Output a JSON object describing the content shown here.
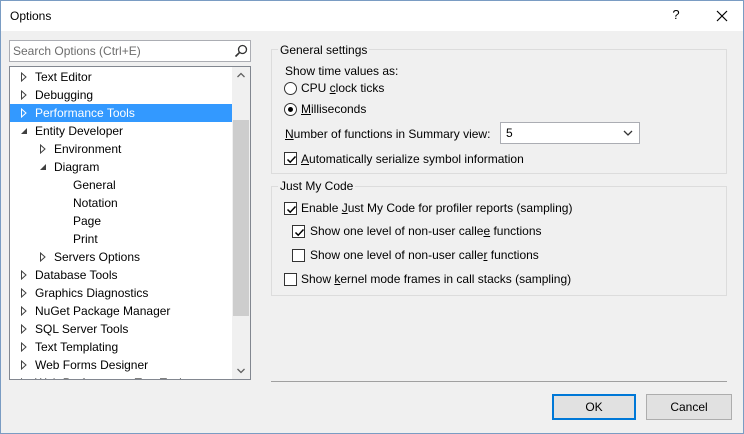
{
  "window": {
    "title": "Options",
    "help_glyph": "?"
  },
  "search": {
    "placeholder": "Search Options (Ctrl+E)",
    "value": ""
  },
  "tree": {
    "items": [
      {
        "label": "Text Editor",
        "level": 0,
        "expander": "collapsed",
        "selected": false
      },
      {
        "label": "Debugging",
        "level": 0,
        "expander": "collapsed",
        "selected": false
      },
      {
        "label": "Performance Tools",
        "level": 0,
        "expander": "collapsed",
        "selected": true
      },
      {
        "label": "Entity Developer",
        "level": 0,
        "expander": "expanded",
        "selected": false
      },
      {
        "label": "Environment",
        "level": 1,
        "expander": "collapsed",
        "selected": false
      },
      {
        "label": "Diagram",
        "level": 1,
        "expander": "expanded",
        "selected": false
      },
      {
        "label": "General",
        "level": 2,
        "expander": "none",
        "selected": false
      },
      {
        "label": "Notation",
        "level": 2,
        "expander": "none",
        "selected": false
      },
      {
        "label": "Page",
        "level": 2,
        "expander": "none",
        "selected": false
      },
      {
        "label": "Print",
        "level": 2,
        "expander": "none",
        "selected": false
      },
      {
        "label": "Servers Options",
        "level": 1,
        "expander": "collapsed",
        "selected": false
      },
      {
        "label": "Database Tools",
        "level": 0,
        "expander": "collapsed",
        "selected": false
      },
      {
        "label": "Graphics Diagnostics",
        "level": 0,
        "expander": "collapsed",
        "selected": false
      },
      {
        "label": "NuGet Package Manager",
        "level": 0,
        "expander": "collapsed",
        "selected": false
      },
      {
        "label": "SQL Server Tools",
        "level": 0,
        "expander": "collapsed",
        "selected": false
      },
      {
        "label": "Text Templating",
        "level": 0,
        "expander": "collapsed",
        "selected": false
      },
      {
        "label": "Web Forms Designer",
        "level": 0,
        "expander": "collapsed",
        "selected": false
      },
      {
        "label": "Web Performance Test Tools",
        "level": 0,
        "expander": "collapsed",
        "selected": false
      }
    ]
  },
  "general_settings": {
    "title": "General settings",
    "time_values_label": "Show time values as:",
    "cpu_ticks": {
      "pre": "CPU ",
      "accel": "c",
      "post": "lock ticks",
      "checked": false
    },
    "milliseconds": {
      "pre": "",
      "accel": "M",
      "post": "illiseconds",
      "checked": true
    },
    "functions_label": {
      "pre": "",
      "accel": "N",
      "post": "umber of functions in Summary view:"
    },
    "functions_value": "5",
    "auto_serialize": {
      "pre": "",
      "accel": "A",
      "post": "utomatically serialize symbol information",
      "checked": true
    }
  },
  "just_my_code": {
    "title": "Just My Code",
    "enable": {
      "pre": "Enable ",
      "accel": "J",
      "post": "ust My Code for profiler reports (sampling)",
      "checked": true
    },
    "callee": {
      "pre": "Show one level of non-user calle",
      "accel": "e",
      "post": " functions",
      "checked": true
    },
    "caller": {
      "pre": "Show one level of non-user calle",
      "accel": "r",
      "post": " functions",
      "checked": false
    },
    "kernel": {
      "pre": "Show ",
      "accel": "k",
      "post": "ernel mode frames in call stacks (sampling)",
      "checked": false
    }
  },
  "buttons": {
    "ok": "OK",
    "cancel": "Cancel"
  }
}
